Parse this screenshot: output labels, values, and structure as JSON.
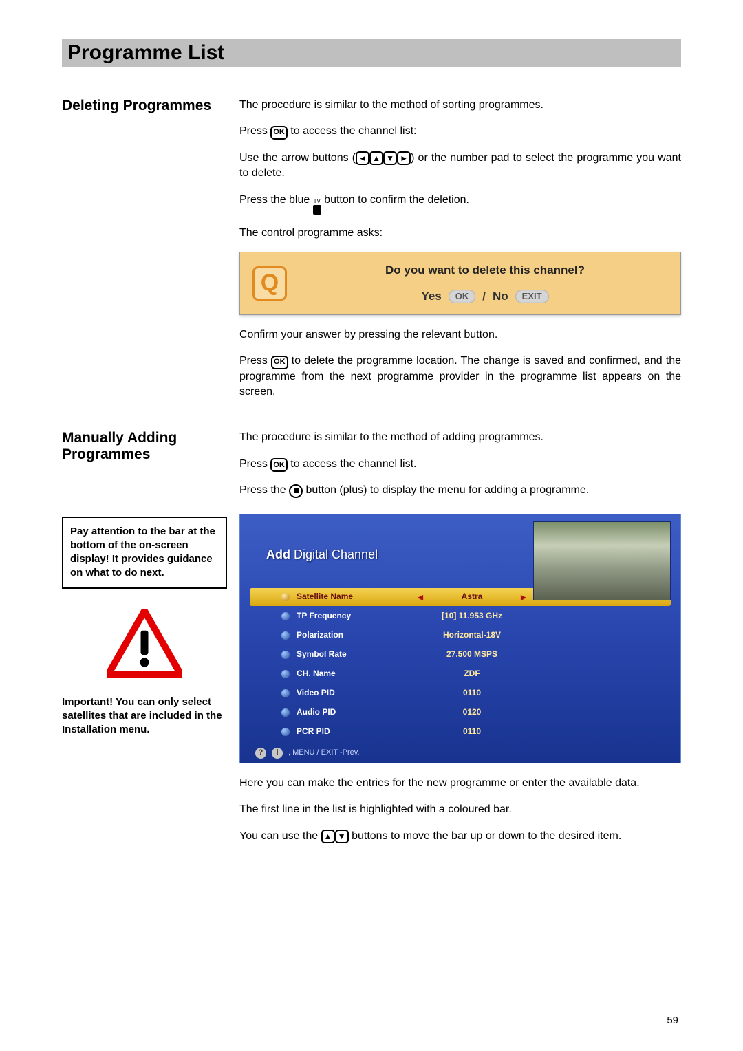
{
  "title": "Programme List",
  "page_number": "59",
  "sections": {
    "deleting": {
      "heading": "Deleting Programmes",
      "p1": "The procedure is similar to the method of sorting programmes.",
      "p2a": "Press ",
      "p2b": " to access the channel list:",
      "p3a": "Use the arrow buttons (",
      "p3b": ") or the number pad to select the programme you want to delete.",
      "p4a": "Press the blue ",
      "p4b": " button to confirm the deletion.",
      "p5": "The control programme asks:",
      "dialog": {
        "question": "Do you want to delete this channel?",
        "yes": "Yes",
        "ok": "OK",
        "sep": "/",
        "no": "No",
        "exit": "EXIT"
      },
      "p6": "Confirm your answer by pressing the relevant button.",
      "p7a": "Press ",
      "p7b": " to delete the programme location. The change is saved and confirmed, and the programme from the next programme provider in the programme list appears on the screen."
    },
    "adding": {
      "heading": "Manually Adding Programmes",
      "p1": "The procedure is similar to the method of adding programmes.",
      "p2a": "Press ",
      "p2b": " to access the channel list.",
      "p3a": "Press the ",
      "p3b": " button (plus) to display the menu for adding a programme.",
      "tip": "Pay attention to the bar at the bottom of the on-screen display! It provides guidance on what to do next.",
      "important": "Important! You can only select satellites that are included in the Installation menu.",
      "osd": {
        "title_prefix": "Add",
        "title_rest": " Digital Channel",
        "rows": [
          {
            "label": "Satellite Name",
            "value": "Astra",
            "hl": true,
            "arrows": true
          },
          {
            "label": "TP Frequency",
            "value": "[10] 11.953 GHz"
          },
          {
            "label": "Polarization",
            "value": "Horizontal-18V"
          },
          {
            "label": "Symbol Rate",
            "value": "27.500 MSPS"
          },
          {
            "label": "CH. Name",
            "value": "ZDF"
          },
          {
            "label": "Video PID",
            "value": "0110"
          },
          {
            "label": "Audio PID",
            "value": "0120"
          },
          {
            "label": "PCR PID",
            "value": "0110"
          }
        ],
        "footer": ", MENU / EXIT -Prev."
      },
      "p4": "Here you can make the entries for the new programme or enter the available data.",
      "p5": "The first line in the list is highlighted with a coloured bar.",
      "p6a": "You can use the ",
      "p6b": " buttons to move the bar up or down to the desired item."
    }
  },
  "icons": {
    "ok": "OK"
  }
}
